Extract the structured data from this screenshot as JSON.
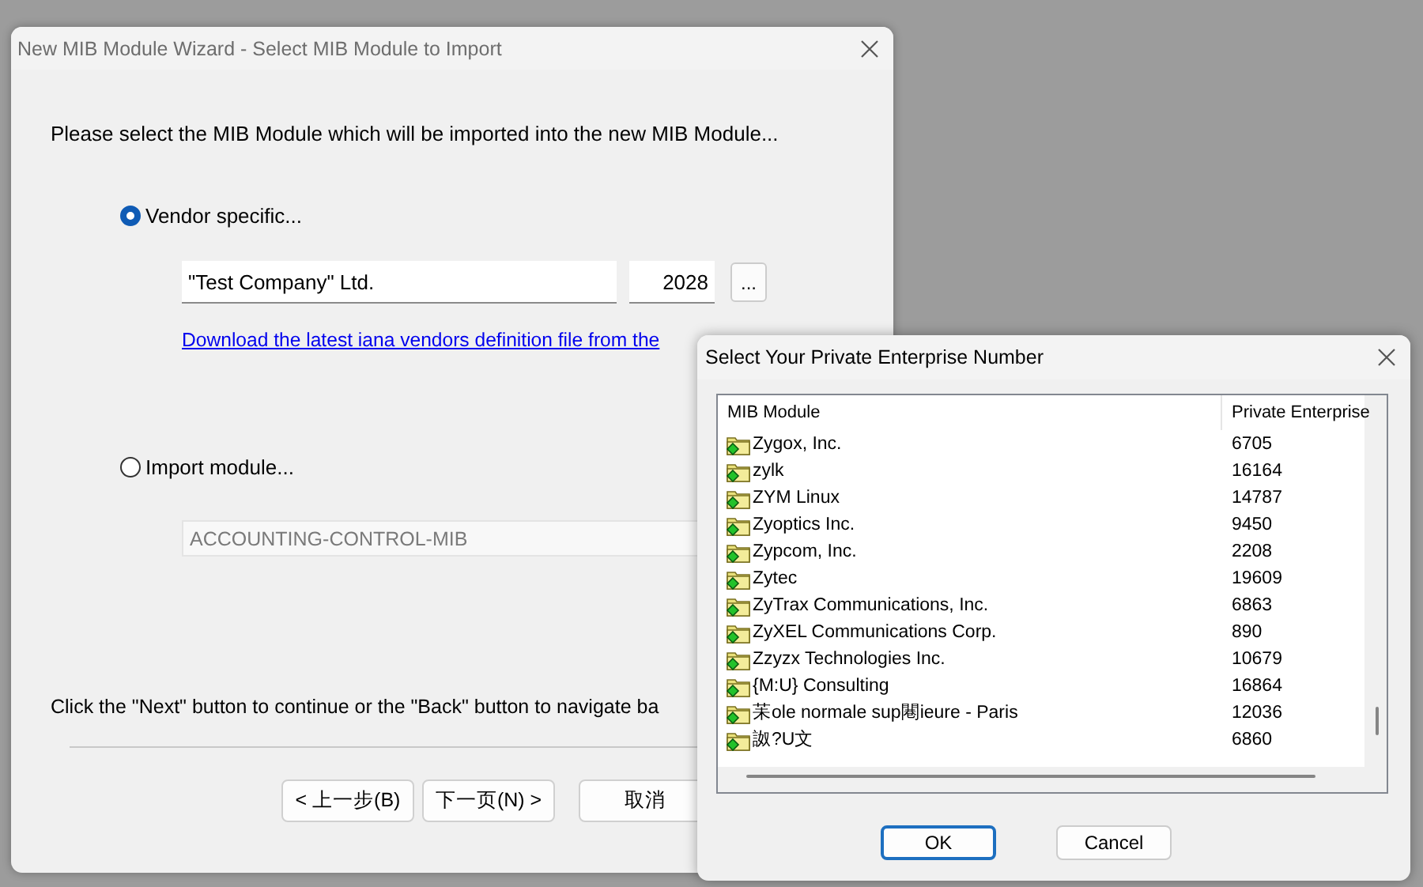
{
  "wizard": {
    "title": "New MIB Module Wizard - Select MIB Module to Import",
    "instruction": "Please select the MIB Module which will be imported into the new MIB Module...",
    "options": [
      {
        "label": "Vendor specific...",
        "selected": true
      },
      {
        "label": "Import module...",
        "selected": false
      }
    ],
    "vendor_name": "\"Test Company\" Ltd.",
    "vendor_number": "2028",
    "browse_button": "...",
    "link": "Download the latest iana vendors definition file from the",
    "module": {
      "value": "ACCOUNTING-CONTROL-MIB",
      "disabled": true
    },
    "footer": "Click the \"Next\" button to continue or the \"Back\" button to navigate ba",
    "buttons": [
      {
        "label": "< 上一步(B)"
      },
      {
        "label": "下一页(N) >"
      },
      {
        "label": "取消"
      }
    ]
  },
  "dialog": {
    "title": "Select Your Private Enterprise Number",
    "columns": [
      "MIB Module",
      "Private Enterprise"
    ],
    "rows": [
      {
        "name": "Zygox, Inc.",
        "number": "6705"
      },
      {
        "name": "zylk",
        "number": "16164"
      },
      {
        "name": "ZYM Linux",
        "number": "14787"
      },
      {
        "name": "Zyoptics Inc.",
        "number": "9450"
      },
      {
        "name": "Zypcom, Inc.",
        "number": "2208"
      },
      {
        "name": "Zytec",
        "number": "19609"
      },
      {
        "name": "ZyTrax Communications, Inc.",
        "number": "6863"
      },
      {
        "name": "ZyXEL Communications Corp.",
        "number": "890"
      },
      {
        "name": "Zzyzx Technologies Inc.",
        "number": "10679"
      },
      {
        "name": "{M:U} Consulting",
        "number": "16864"
      },
      {
        "name": "苿ole normale sup闀ieure - Paris",
        "number": "12036"
      },
      {
        "name": "詉?U文",
        "number": "6860"
      }
    ],
    "buttons": [
      {
        "label": "OK",
        "default": true
      },
      {
        "label": "Cancel",
        "default": false
      }
    ]
  }
}
